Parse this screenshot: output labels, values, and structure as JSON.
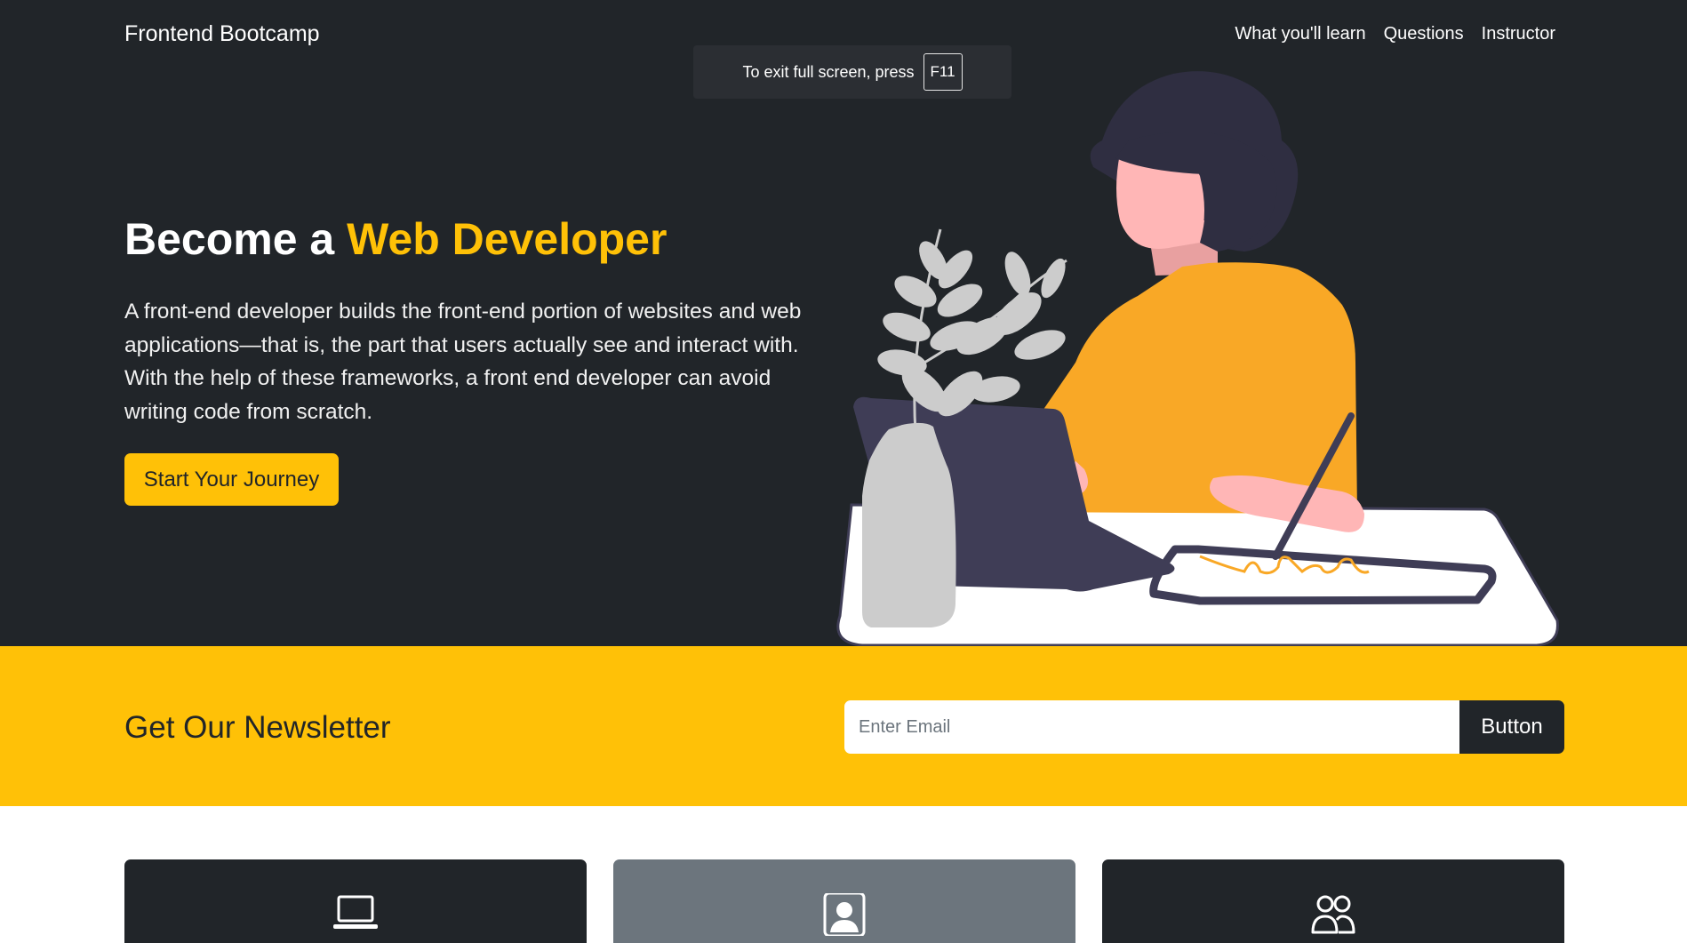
{
  "navbar": {
    "brand": "Frontend Bootcamp",
    "links": [
      "What you'll learn",
      "Questions",
      "Instructor"
    ]
  },
  "fullscreen_notice": {
    "text": "To exit full screen, press",
    "key": "F11"
  },
  "hero": {
    "title_prefix": "Become a",
    "title_highlight": "Web Developer",
    "description": "A front-end developer builds the front-end portion of websites and web applications—that is, the part that users actually see and interact with. With the help of these frameworks, a front end developer can avoid writing code from scratch.",
    "cta_label": "Start Your Journey",
    "illustration": "woman-drawing-on-tablet-illustration"
  },
  "newsletter": {
    "title": "Get Our Newsletter",
    "input_placeholder": "Enter Email",
    "input_value": "",
    "button_label": "Button"
  },
  "cards": [
    {
      "icon": "laptop-icon",
      "background": "#212529"
    },
    {
      "icon": "person-badge-icon",
      "background": "#6c757d"
    },
    {
      "icon": "people-icon",
      "background": "#212529"
    }
  ],
  "colors": {
    "dark": "#212529",
    "accent": "#ffc107",
    "secondary": "#6c757d",
    "white": "#ffffff"
  }
}
